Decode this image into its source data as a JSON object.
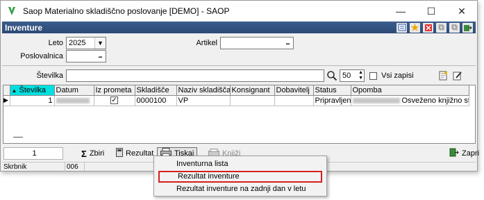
{
  "window": {
    "title": "Saop Materialno skladiščno poslovanje [DEMO] - SAOP"
  },
  "header": {
    "title": "Inventure"
  },
  "form": {
    "leto_label": "Leto",
    "leto_value": "2025",
    "poslovalnica_label": "Poslovalnica",
    "poslovalnica_value": "",
    "artikel_label": "Artikel",
    "artikel_value": "",
    "stevilka_label": "Številka",
    "stevilka_value": "",
    "limit_value": "50",
    "vsi_zapisi_label": "Vsi zapisi",
    "ellipsis": "..."
  },
  "grid": {
    "columns": [
      "Številka",
      "Datum",
      "Iz prometa",
      "Skladišče",
      "Naziv skladišča",
      "Konsignant",
      "Dobavitelj",
      "Status",
      "Opomba"
    ],
    "rows": [
      {
        "stevilka": "1",
        "datum": "",
        "iz_prometa": "✓",
        "skladisce": "0000100",
        "naziv": "VP",
        "konsignant": "",
        "dobavitelj": "",
        "status": "Pripravljen",
        "opomba": "Osveženo knjižno stanje"
      }
    ]
  },
  "toolbar": {
    "record_count": "1",
    "zbiri_label": "Zbiri",
    "rezultat_label": "Rezultat",
    "tiskaj_label": "Tiskaj",
    "knjizi_label": "Knjiži",
    "zapri_label": "Zapri"
  },
  "status": {
    "user": "Skrbnik",
    "code": "006"
  },
  "print_menu": {
    "items": [
      "Inventurna lista",
      "Rezultat inventure",
      "Rezultat inventure na zadnji dan v letu"
    ]
  },
  "colors": {
    "header_bg": "#2c4a76",
    "sort_column": "#00e0e0",
    "highlight_border": "#d71e1e"
  }
}
